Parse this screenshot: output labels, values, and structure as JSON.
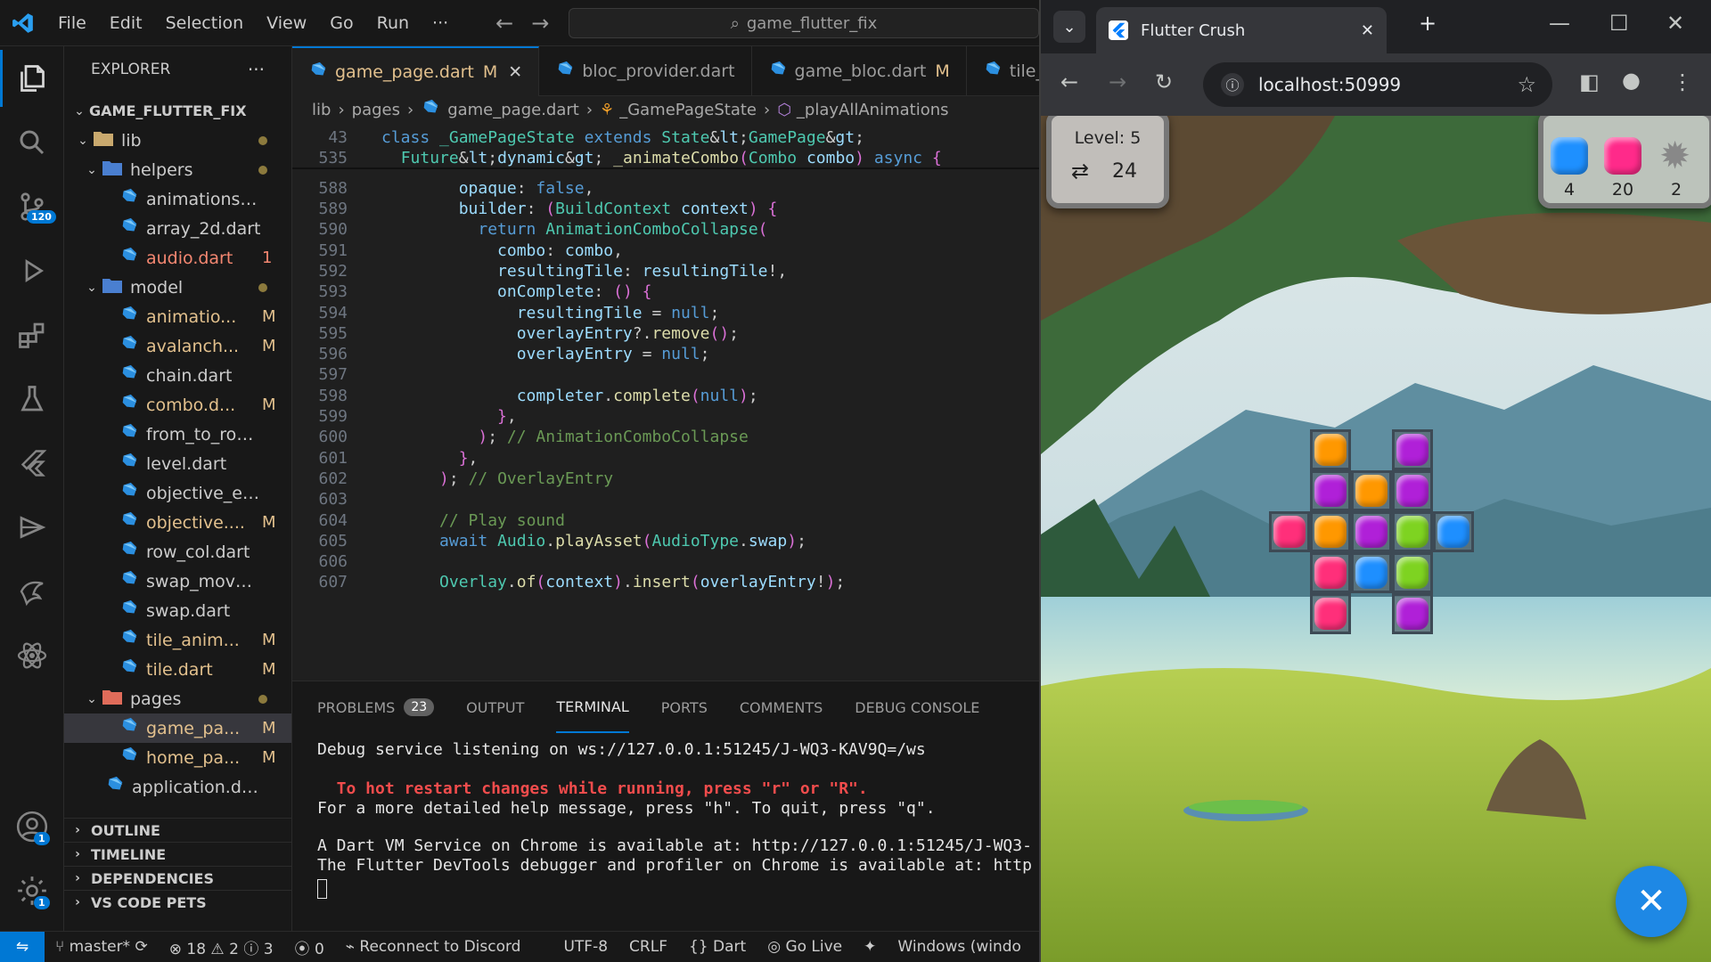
{
  "vscode": {
    "menu": [
      "File",
      "Edit",
      "Selection",
      "View",
      "Go",
      "Run",
      "···"
    ],
    "search_text": "game_flutter_fix",
    "activity": [
      {
        "icon": "explorer-icon"
      },
      {
        "icon": "search-icon"
      },
      {
        "icon": "source-control-icon",
        "badge": "120"
      },
      {
        "icon": "run-debug-icon"
      },
      {
        "icon": "extensions-icon"
      },
      {
        "icon": "testing-icon"
      },
      {
        "icon": "flutter-icon"
      },
      {
        "icon": "remote-icon"
      },
      {
        "icon": "dart-devtools-icon"
      },
      {
        "icon": "react-icon"
      }
    ],
    "accounts_badge": "1",
    "settings_badge": "1",
    "explorer": {
      "title": "EXPLORER",
      "more": "···",
      "project": "GAME_FLUTTER_FIX",
      "tree": [
        {
          "name": "lib",
          "kind": "folder",
          "indent": 1,
          "open": true,
          "dot": true
        },
        {
          "name": "helpers",
          "kind": "folder",
          "indent": 2,
          "open": true,
          "dot": true
        },
        {
          "name": "animations_res...",
          "kind": "file",
          "indent": 3,
          "badge": ""
        },
        {
          "name": "array_2d.dart",
          "kind": "file",
          "indent": 3,
          "badge": ""
        },
        {
          "name": "audio.dart",
          "kind": "file",
          "indent": 3,
          "badge": "1",
          "err": true
        },
        {
          "name": "model",
          "kind": "folder",
          "indent": 2,
          "open": true,
          "dot": true
        },
        {
          "name": "animatio...",
          "kind": "file",
          "indent": 3,
          "badge": "M"
        },
        {
          "name": "avalanch...",
          "kind": "file",
          "indent": 3,
          "badge": "M"
        },
        {
          "name": "chain.dart",
          "kind": "file",
          "indent": 3,
          "badge": ""
        },
        {
          "name": "combo.d...",
          "kind": "file",
          "indent": 3,
          "badge": "M"
        },
        {
          "name": "from_to_row_c...",
          "kind": "file",
          "indent": 3,
          "badge": ""
        },
        {
          "name": "level.dart",
          "kind": "file",
          "indent": 3,
          "badge": ""
        },
        {
          "name": "objective_even...",
          "kind": "file",
          "indent": 3,
          "badge": ""
        },
        {
          "name": "objective....",
          "kind": "file",
          "indent": 3,
          "badge": "M"
        },
        {
          "name": "row_col.dart",
          "kind": "file",
          "indent": 3,
          "badge": ""
        },
        {
          "name": "swap_move.dart",
          "kind": "file",
          "indent": 3,
          "badge": ""
        },
        {
          "name": "swap.dart",
          "kind": "file",
          "indent": 3,
          "badge": ""
        },
        {
          "name": "tile_anim...",
          "kind": "file",
          "indent": 3,
          "badge": "M"
        },
        {
          "name": "tile.dart",
          "kind": "file",
          "indent": 3,
          "badge": "M"
        },
        {
          "name": "pages",
          "kind": "folder",
          "indent": 2,
          "open": true,
          "dot": true
        },
        {
          "name": "game_pa...",
          "kind": "file",
          "indent": 3,
          "badge": "M",
          "selected": true
        },
        {
          "name": "home_pa...",
          "kind": "file",
          "indent": 3,
          "badge": "M"
        },
        {
          "name": "application.dart",
          "kind": "file",
          "indent": 2,
          "badge": ""
        }
      ],
      "sections": [
        "OUTLINE",
        "TIMELINE",
        "DEPENDENCIES",
        "VS CODE PETS"
      ]
    },
    "tabs": [
      {
        "label": "game_page.dart",
        "mod": "M",
        "active": true,
        "close": "✕"
      },
      {
        "label": "bloc_provider.dart",
        "mod": "",
        "active": false
      },
      {
        "label": "game_bloc.dart",
        "mod": "M",
        "active": false
      },
      {
        "label": "tile_a",
        "mod": "",
        "active": false
      }
    ],
    "breadcrumb": [
      "lib",
      "pages",
      "game_page.dart",
      "_GamePageState",
      "_playAllAnimations"
    ],
    "code": [
      {
        "n": "43",
        "t": "class _GamePageState extends State<GamePage>"
      },
      {
        "n": "535",
        "t": "  Future<dynamic> _animateCombo(Combo combo) async {"
      },
      {
        "n": "588",
        "t": "        opaque: false,"
      },
      {
        "n": "589",
        "t": "        builder: (BuildContext context) {"
      },
      {
        "n": "590",
        "t": "          return AnimationComboCollapse("
      },
      {
        "n": "591",
        "t": "            combo: combo,"
      },
      {
        "n": "592",
        "t": "            resultingTile: resultingTile!,"
      },
      {
        "n": "593",
        "t": "            onComplete: () {"
      },
      {
        "n": "594",
        "t": "              resultingTile = null;"
      },
      {
        "n": "595",
        "t": "              overlayEntry?.remove();"
      },
      {
        "n": "596",
        "t": "              overlayEntry = null;"
      },
      {
        "n": "597",
        "t": ""
      },
      {
        "n": "598",
        "t": "              completer.complete(null);"
      },
      {
        "n": "599",
        "t": "            },"
      },
      {
        "n": "600",
        "t": "          ); // AnimationComboCollapse"
      },
      {
        "n": "601",
        "t": "        },"
      },
      {
        "n": "602",
        "t": "      ); // OverlayEntry"
      },
      {
        "n": "603",
        "t": ""
      },
      {
        "n": "604",
        "t": "      // Play sound"
      },
      {
        "n": "605",
        "t": "      await Audio.playAsset(AudioType.swap);"
      },
      {
        "n": "606",
        "t": ""
      },
      {
        "n": "607",
        "t": "      Overlay.of(context).insert(overlayEntry!);"
      }
    ],
    "panel_tabs": [
      "PROBLEMS",
      "OUTPUT",
      "TERMINAL",
      "PORTS",
      "COMMENTS",
      "DEBUG CONSOLE"
    ],
    "problems_count": "23",
    "terminal": [
      "Debug service listening on ws://127.0.0.1:51245/J-WQ3-KAV9Q=/ws",
      "  To hot restart changes while running, press \"r\" or \"R\".",
      "For a more detailed help message, press \"h\". To quit, press \"q\".",
      "A Dart VM Service on Chrome is available at: http://127.0.0.1:51245/J-WQ3-",
      "The Flutter DevTools debugger and profiler on Chrome is available at: http"
    ],
    "status": {
      "branch": "master*",
      "errors": "18",
      "warnings": "2",
      "infos": "3",
      "ports": "0",
      "discord": "Reconnect to Discord",
      "encoding": "UTF-8",
      "eol": "CRLF",
      "lang": "Dart",
      "golive": "Go Live",
      "device": "Windows (windo"
    }
  },
  "chrome": {
    "tab_title": "Flutter Crush",
    "url": "localhost:50999",
    "game": {
      "level_label": "Level: 5",
      "moves": "24",
      "objectives": [
        {
          "color": "#1e90ff",
          "count": "4"
        },
        {
          "color": "#ff2a8a",
          "count": "20"
        },
        {
          "color": "#bbbbbb",
          "count": "2"
        }
      ],
      "colors": {
        "orange": "#ff9800",
        "purple": "#b020d8",
        "pink": "#ff2f7a",
        "green": "#7ed321",
        "blue": "#1e8fff"
      },
      "grid": [
        [
          "",
          "orange",
          "",
          "purple",
          ""
        ],
        [
          "",
          "purple",
          "orange",
          "purple",
          ""
        ],
        [
          "pink",
          "orange",
          "purple",
          "green",
          "blue"
        ],
        [
          "",
          "pink",
          "blue",
          "green",
          ""
        ],
        [
          "",
          "pink",
          "",
          "purple",
          ""
        ]
      ]
    }
  }
}
